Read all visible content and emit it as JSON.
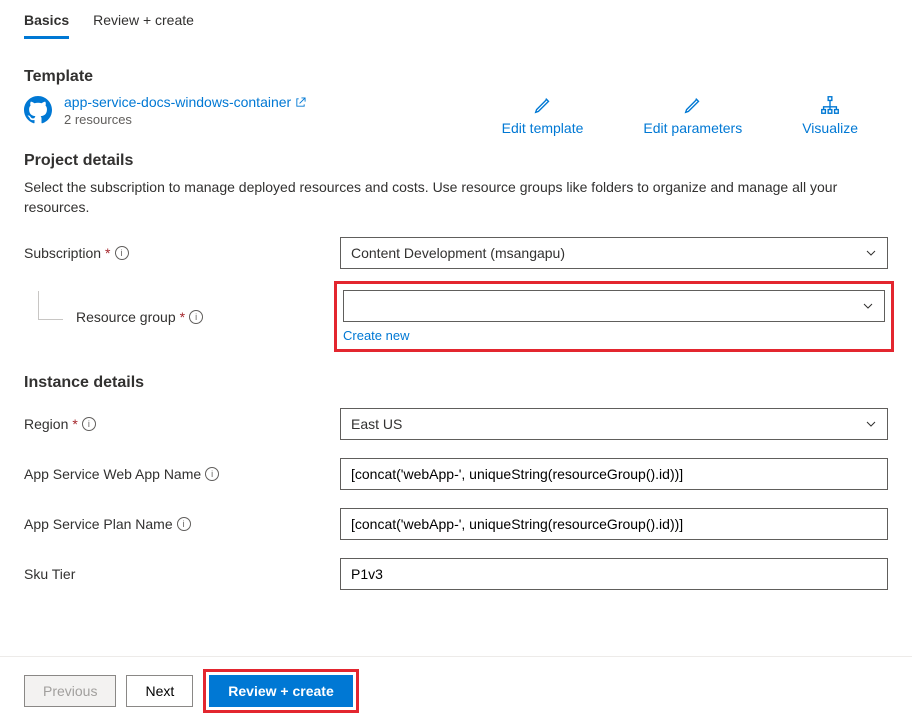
{
  "tabs": {
    "basics": "Basics",
    "review": "Review + create"
  },
  "template": {
    "heading": "Template",
    "linkText": "app-service-docs-windows-container",
    "resourcesCount": "2 resources",
    "actions": {
      "edit": "Edit template",
      "params": "Edit parameters",
      "visualize": "Visualize"
    }
  },
  "project": {
    "heading": "Project details",
    "desc": "Select the subscription to manage deployed resources and costs. Use resource groups like folders to organize and manage all your resources.",
    "subscriptionLabel": "Subscription",
    "subscriptionValue": "Content Development (msangapu)",
    "resourceGroupLabel": "Resource group",
    "resourceGroupValue": "",
    "createNew": "Create new"
  },
  "instance": {
    "heading": "Instance details",
    "regionLabel": "Region",
    "regionValue": "East US",
    "webAppLabel": "App Service Web App Name",
    "webAppValue": "[concat('webApp-', uniqueString(resourceGroup().id))]",
    "planLabel": "App Service Plan Name",
    "planValue": "[concat('webApp-', uniqueString(resourceGroup().id))]",
    "skuLabel": "Sku Tier",
    "skuValue": "P1v3"
  },
  "footer": {
    "previous": "Previous",
    "next": "Next",
    "review": "Review + create"
  }
}
